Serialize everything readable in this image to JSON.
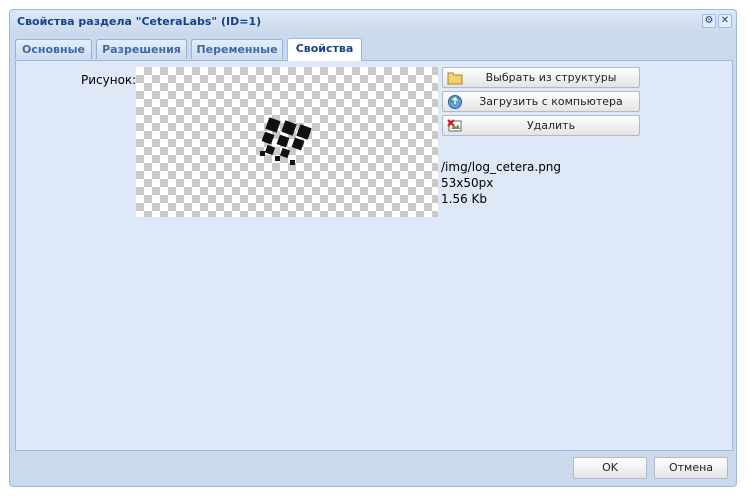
{
  "window": {
    "title": "Свойства раздела \"CeteraLabs\" (ID=1)"
  },
  "tools": [
    {
      "name": "gear-icon",
      "glyph": "⚙"
    },
    {
      "name": "close-icon",
      "glyph": "✕"
    }
  ],
  "tabs": [
    {
      "label": "Основные"
    },
    {
      "label": "Разрешения"
    },
    {
      "label": "Переменные"
    },
    {
      "label": "Свойства",
      "active": true
    }
  ],
  "picture": {
    "label": "Рисунок:",
    "path": "/img/log_cetera.png",
    "dimensions": "53x50px",
    "size": "1.56 Kb"
  },
  "actions": {
    "choose_label": "Выбрать из структуры",
    "upload_label": "Загрузить с компьютера",
    "delete_label": "Удалить"
  },
  "footer": {
    "ok_label": "OK",
    "cancel_label": "Отмена"
  },
  "colors": {
    "title_text": "#15428b",
    "frame_border": "#99bbe8",
    "panel_bg": "#dfe8f6"
  }
}
